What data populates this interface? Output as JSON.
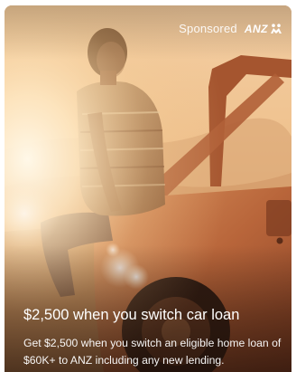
{
  "ad": {
    "sponsored_label": "Sponsored",
    "brand_name": "ANZ",
    "brand_icon": "anz-people-icon",
    "title": "$2,500 when you switch car loan",
    "description": "Get $2,500 when you switch an eligible home loan of $60K+ to ANZ including any new lending.",
    "image": "man-sitting-on-jeep-sunset-photo"
  },
  "colors": {
    "text": "#ffffff",
    "sun": "#fff4dc",
    "jeep": "#b8623a"
  }
}
